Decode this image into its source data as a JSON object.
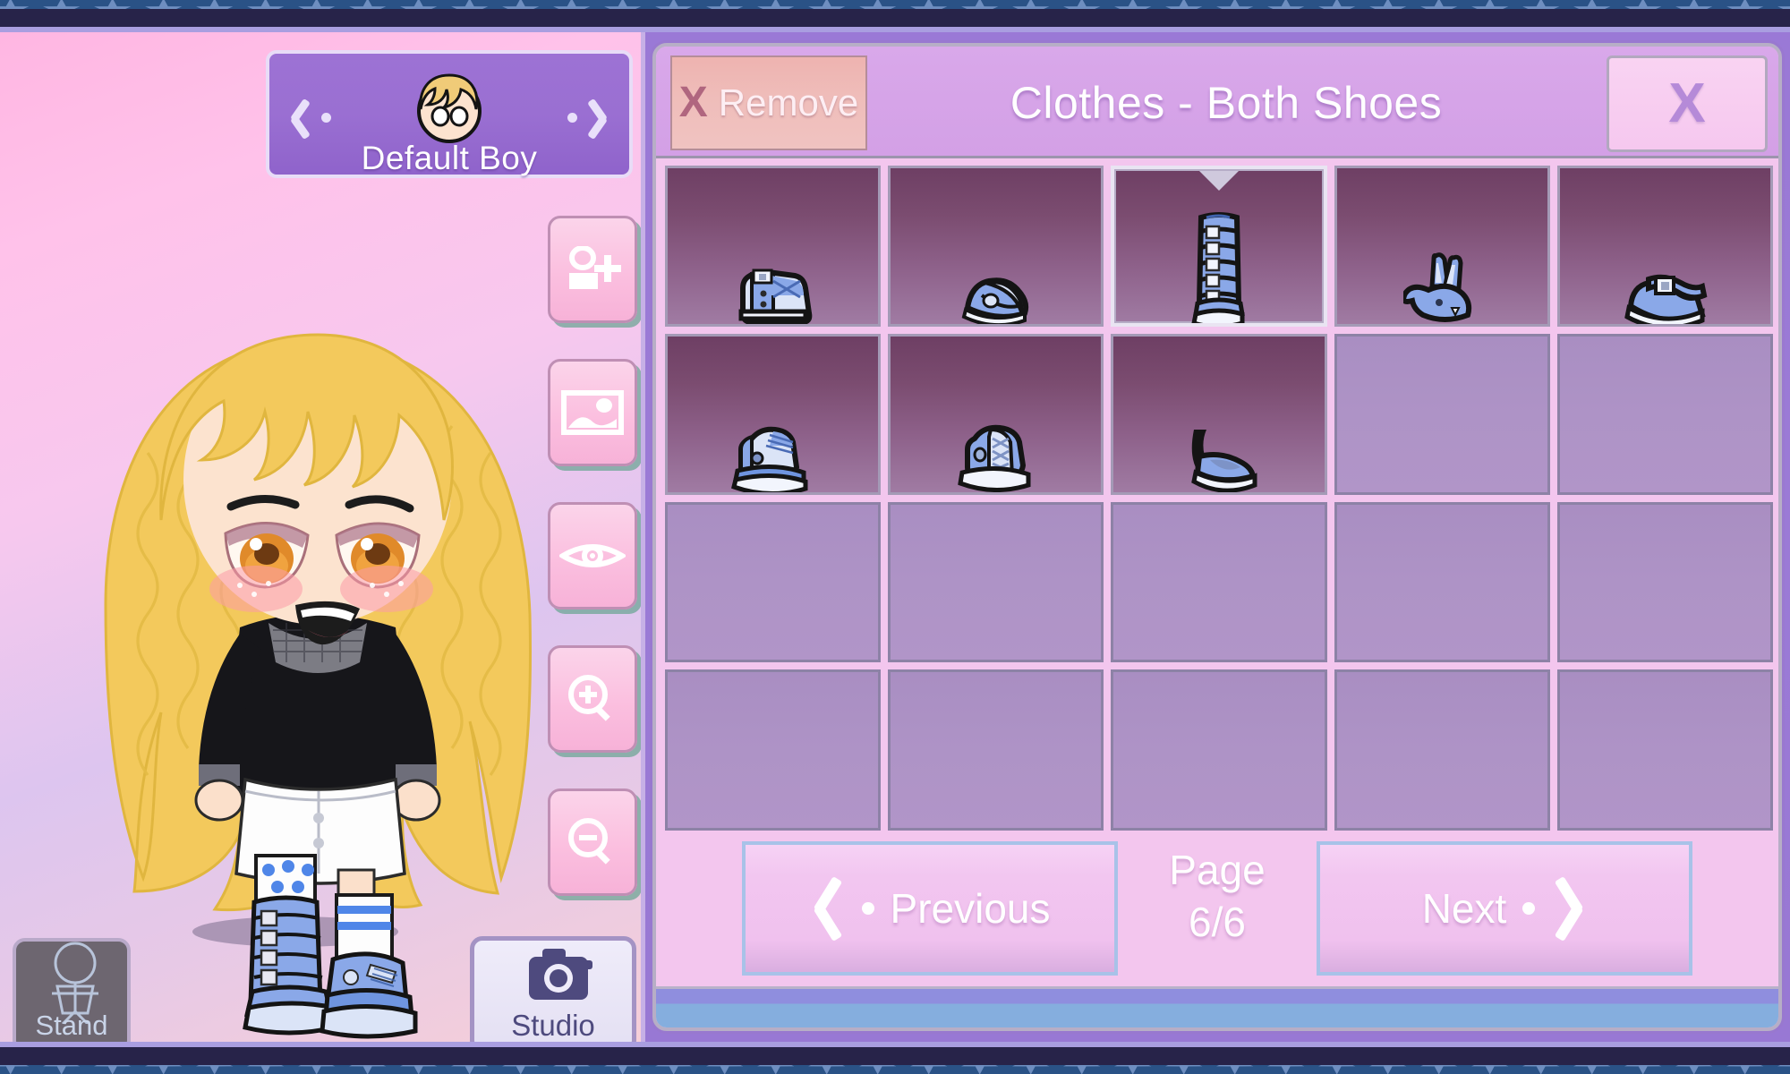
{
  "window": {
    "frame_color": "#272349",
    "band_color": "#2a5286",
    "star_color": "#6e8ec0",
    "stage_color": "#9a79d6"
  },
  "character_panel": {
    "name_selector": {
      "prev_arrow": "chevron-left-dot",
      "next_arrow": "chevron-right-dot",
      "avatar": "character-head-avatar",
      "name": "Default Boy"
    },
    "tools": [
      {
        "name": "add-character",
        "icon": "person-plus-icon"
      },
      {
        "name": "background",
        "icon": "image-icon"
      },
      {
        "name": "preview-eye",
        "icon": "eye-icon"
      },
      {
        "name": "zoom-in",
        "icon": "magnifier-plus-icon"
      },
      {
        "name": "zoom-out",
        "icon": "magnifier-minus-icon"
      }
    ],
    "stand_button": {
      "label": "Stand",
      "icon": "standing-figure-icon"
    },
    "studio_button": {
      "label": "Studio",
      "icon": "camera-icon"
    },
    "character": {
      "hair": "curly-long-blonde",
      "hair_color": "#f5cb5c",
      "eye_color": "#e08a2a",
      "top": "black-long-sleeve-mesh",
      "bottom": "white-shorts",
      "left_leg": "polka-dot-sock-buckle-boot",
      "right_leg": "striped-sock-platform-sneaker"
    }
  },
  "item_panel": {
    "remove_button": {
      "x_glyph": "X",
      "label": "Remove"
    },
    "title": "Clothes - Both Shoes",
    "close_button": {
      "glyph": "X"
    },
    "grid": {
      "columns": 5,
      "rows": 4,
      "selected_index": 2,
      "cells": [
        {
          "name": "shoe-item-1",
          "icon": "blue-buckle-ankle-boot",
          "empty": false
        },
        {
          "name": "shoe-item-2",
          "icon": "blue-mary-jane-flat",
          "empty": false
        },
        {
          "name": "shoe-item-3",
          "icon": "blue-tall-buckle-boot",
          "empty": false
        },
        {
          "name": "shoe-item-4",
          "icon": "blue-bunny-slipper",
          "empty": false
        },
        {
          "name": "shoe-item-5",
          "icon": "blue-strap-buckle-shoe",
          "empty": false
        },
        {
          "name": "shoe-item-6",
          "icon": "blue-platform-sneaker",
          "empty": false
        },
        {
          "name": "shoe-item-7",
          "icon": "blue-lace-up-sneaker",
          "empty": false
        },
        {
          "name": "shoe-item-8",
          "icon": "blue-ankle-strap-heel",
          "empty": false
        },
        {
          "name": "shoe-item-9",
          "icon": "",
          "empty": true
        },
        {
          "name": "shoe-item-10",
          "icon": "",
          "empty": true
        },
        {
          "name": "shoe-item-11",
          "icon": "",
          "empty": true
        },
        {
          "name": "shoe-item-12",
          "icon": "",
          "empty": true
        },
        {
          "name": "shoe-item-13",
          "icon": "",
          "empty": true
        },
        {
          "name": "shoe-item-14",
          "icon": "",
          "empty": true
        },
        {
          "name": "shoe-item-15",
          "icon": "",
          "empty": true
        },
        {
          "name": "shoe-item-16",
          "icon": "",
          "empty": true
        },
        {
          "name": "shoe-item-17",
          "icon": "",
          "empty": true
        },
        {
          "name": "shoe-item-18",
          "icon": "",
          "empty": true
        },
        {
          "name": "shoe-item-19",
          "icon": "",
          "empty": true
        },
        {
          "name": "shoe-item-20",
          "icon": "",
          "empty": true
        }
      ]
    },
    "pager": {
      "previous_label": "Previous",
      "next_label": "Next",
      "page_word": "Page",
      "page_value": "6/6"
    }
  },
  "colors": {
    "panel_pink": "#f3c6ee",
    "title_purple": "#d9a8ea",
    "remove_salmon": "#eeb3b0",
    "cell_filled_top": "#6e3f64",
    "cell_empty": "#ae93c6",
    "shoe_blue": "#8aa8e8",
    "accent_blue_border": "#a8c2e8"
  }
}
